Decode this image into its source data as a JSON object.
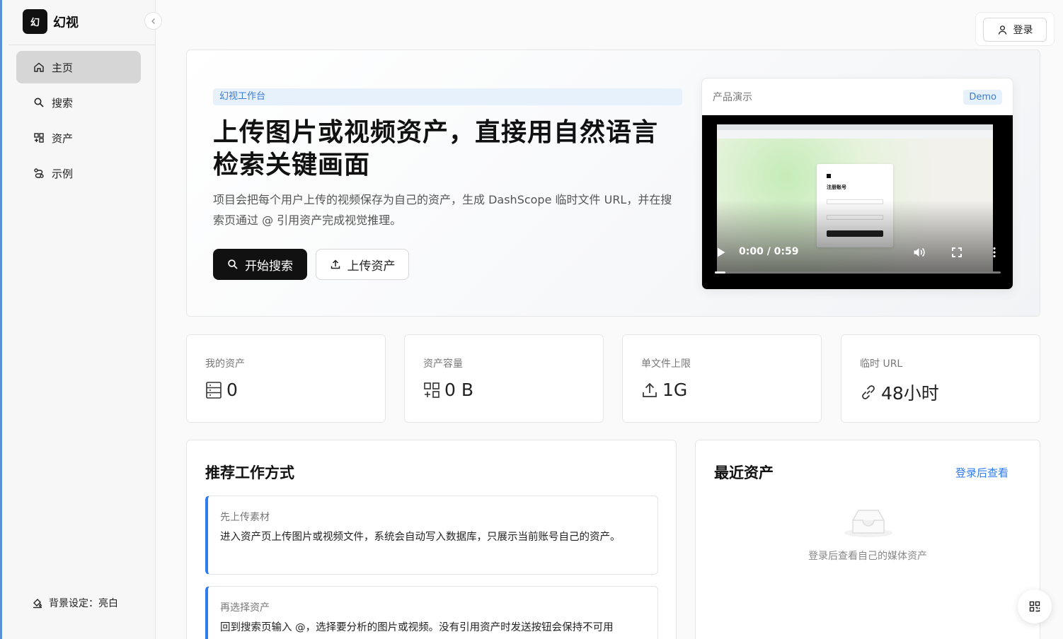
{
  "brand": {
    "logo_text": "幻",
    "name": "幻视"
  },
  "sidebar": {
    "items": [
      {
        "label": "主页",
        "icon": "home-icon",
        "active": true
      },
      {
        "label": "搜索",
        "icon": "search-icon",
        "active": false
      },
      {
        "label": "资产",
        "icon": "grid-icon",
        "active": false
      },
      {
        "label": "示例",
        "icon": "route-icon",
        "active": false
      }
    ],
    "bg_setting": "背景设定：亮白"
  },
  "header": {
    "login_label": "登录"
  },
  "hero": {
    "tag": "幻视工作台",
    "title": "上传图片或视频资产，直接用自然语言检索关键画面",
    "description": "项目会把每个用户上传的视频保存为自己的资产，生成 DashScope 临时文件 URL，并在搜索页通过 @ 引用资产完成视觉推理。",
    "primary_button": "开始搜索",
    "secondary_button": "上传资产",
    "demo": {
      "title": "产品演示",
      "badge": "Demo",
      "time": "0:00 / 0:59",
      "progress": 0.0,
      "frame_heading": "注册账号"
    }
  },
  "stats": [
    {
      "label": "我的资产",
      "value": "0",
      "icon": "database-icon"
    },
    {
      "label": "资产容量",
      "value": "0 B",
      "icon": "grid-icon"
    },
    {
      "label": "单文件上限",
      "value": "1G",
      "icon": "upload-icon"
    },
    {
      "label": "临时 URL",
      "value": "48小时",
      "icon": "link-icon"
    }
  ],
  "workflow": {
    "title": "推荐工作方式",
    "steps": [
      {
        "label": "先上传素材",
        "text": "进入资产页上传图片或视频文件，系统会自动写入数据库，只展示当前账号自己的资产。"
      },
      {
        "label": "再选择资产",
        "text": "回到搜索页输入 @，选择要分析的图片或视频。没有引用资产时发送按钮会保持不可用"
      }
    ]
  },
  "recent": {
    "title": "最近资产",
    "link": "登录后查看",
    "empty_text": "登录后查看自己的媒体资产"
  },
  "colors": {
    "accent": "#2f7bf0",
    "primary": "#111111",
    "tag_bg": "#e7f1fc"
  }
}
